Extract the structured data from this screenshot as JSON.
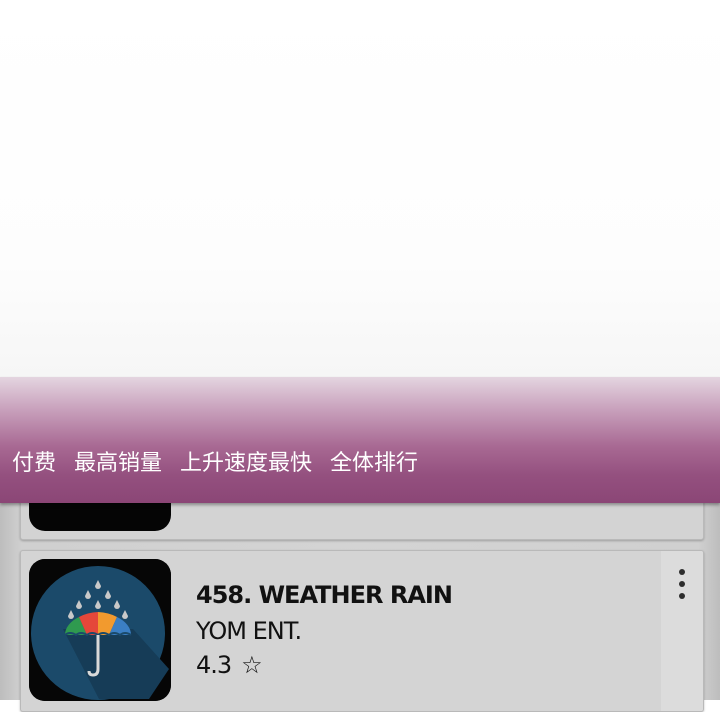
{
  "tabs": [
    {
      "label": "付费"
    },
    {
      "label": "最高销量"
    },
    {
      "label": "上升速度最快"
    },
    {
      "label": "全体排行"
    }
  ],
  "app_list": {
    "items": [
      {
        "title": "458. WEATHER RAIN",
        "developer": "YOM ENT.",
        "rating": "4.3",
        "rating_icon": "star-outline-icon",
        "icon": "umbrella-rain-icon"
      }
    ]
  },
  "colors": {
    "tab_bar_top": "#e4d5e0",
    "tab_bar_bottom": "#8b4676",
    "card_background": "#d4d4d4",
    "icon_circle": "#1b4a6a"
  }
}
